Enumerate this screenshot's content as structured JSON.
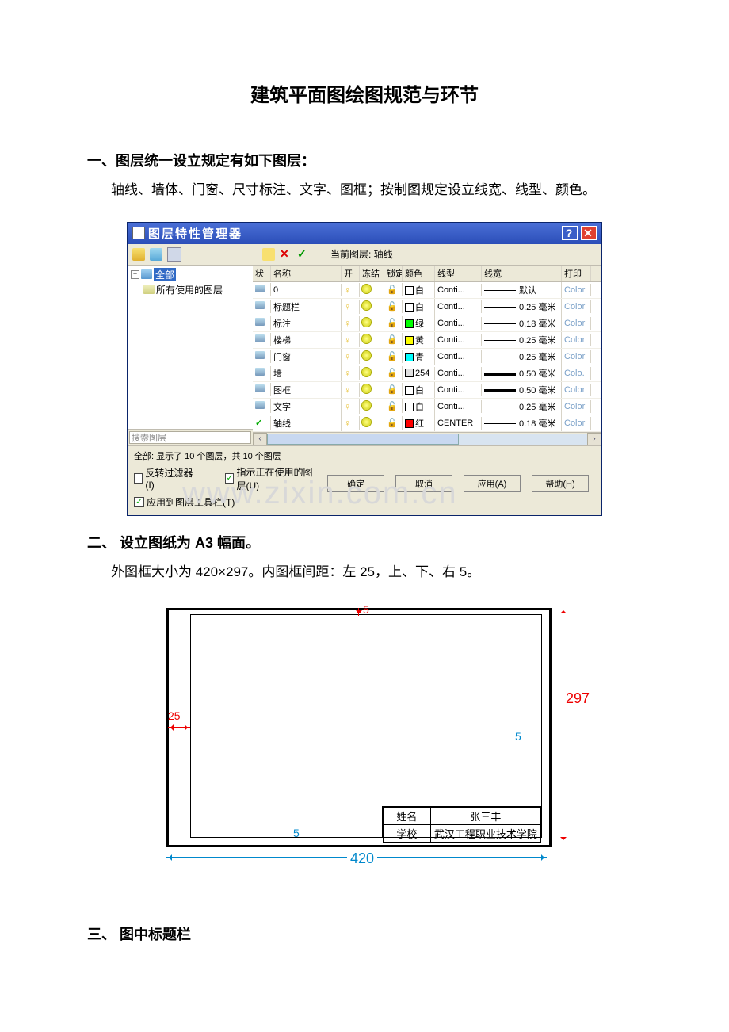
{
  "title": "建筑平面图绘图规范与环节",
  "section1": {
    "heading": "一、图层统一设立规定有如下图层：",
    "text": "轴线、墙体、门窗、尺寸标注、文字、图框；按制图规定设立线宽、线型、颜色。"
  },
  "dialog": {
    "title": "图层特性管理器",
    "toolbar_current_label": "当前图层: 轴线",
    "tree": {
      "root": "全部",
      "child": "所有使用的图层",
      "search_placeholder": "搜索图层"
    },
    "columns": {
      "state": "状",
      "name": "名称",
      "on": "开",
      "freeze": "冻结",
      "lock": "锁定",
      "color": "颜色",
      "ltype": "线型",
      "lw": "线宽",
      "plot": "打印"
    },
    "rows": [
      {
        "name": "0",
        "color_hex": "#ffffff",
        "color_name": "白",
        "ltype": "Conti...",
        "lw": "默认",
        "lw_class": "lw-thin",
        "plot": "Color",
        "current": false
      },
      {
        "name": "标题栏",
        "color_hex": "#ffffff",
        "color_name": "白",
        "ltype": "Conti...",
        "lw": "0.25 毫米",
        "lw_class": "lw-thin",
        "plot": "Color",
        "current": false
      },
      {
        "name": "标注",
        "color_hex": "#00ff00",
        "color_name": "绿",
        "ltype": "Conti...",
        "lw": "0.18 毫米",
        "lw_class": "lw-thin",
        "plot": "Color",
        "current": false
      },
      {
        "name": "楼梯",
        "color_hex": "#ffff00",
        "color_name": "黄",
        "ltype": "Conti...",
        "lw": "0.25 毫米",
        "lw_class": "lw-thin",
        "plot": "Color",
        "current": false
      },
      {
        "name": "门窗",
        "color_hex": "#00ffff",
        "color_name": "青",
        "ltype": "Conti...",
        "lw": "0.25 毫米",
        "lw_class": "lw-thin",
        "plot": "Color",
        "current": false
      },
      {
        "name": "墙",
        "color_hex": "#e0e0e0",
        "color_name": "254",
        "ltype": "Conti...",
        "lw": "0.50 毫米",
        "lw_class": "lw-thick",
        "plot": "Colo.",
        "current": false
      },
      {
        "name": "图框",
        "color_hex": "#ffffff",
        "color_name": "白",
        "ltype": "Conti...",
        "lw": "0.50 毫米",
        "lw_class": "lw-thick",
        "plot": "Color",
        "current": false
      },
      {
        "name": "文字",
        "color_hex": "#ffffff",
        "color_name": "白",
        "ltype": "Conti...",
        "lw": "0.25 毫米",
        "lw_class": "lw-thin",
        "plot": "Color",
        "current": false
      },
      {
        "name": "轴线",
        "color_hex": "#ff0000",
        "color_name": "红",
        "ltype": "CENTER",
        "lw": "0.18 毫米",
        "lw_class": "lw-thin",
        "plot": "Color",
        "current": true
      }
    ],
    "status": "全部: 显示了 10 个图层，共 10 个图层",
    "opt_invert": "反转过滤器(I)",
    "opt_inuse": "指示正在使用的图层(U)",
    "opt_apply_tb": "应用到图层工具栏(T)",
    "btn_ok": "确定",
    "btn_cancel": "取消",
    "btn_apply": "应用(A)",
    "btn_help": "帮助(H)"
  },
  "watermark": "www.zixin.com.cn",
  "section2": {
    "heading": "二、 设立图纸为 A3 幅面。",
    "text": "外图框大小为 420×297。内图框间距：左 25，上、下、右 5。"
  },
  "a3": {
    "dim_top": "5",
    "dim_left": "25",
    "dim_bottom": "5",
    "dim_right_inner": "5",
    "dim_width": "420",
    "dim_height": "297",
    "title_block": {
      "r1c1": "姓名",
      "r1c2": "张三丰",
      "r2c1": "学校",
      "r2c2": "武汉工程职业技术学院"
    }
  },
  "section3": {
    "heading": "三、 图中标题栏"
  }
}
